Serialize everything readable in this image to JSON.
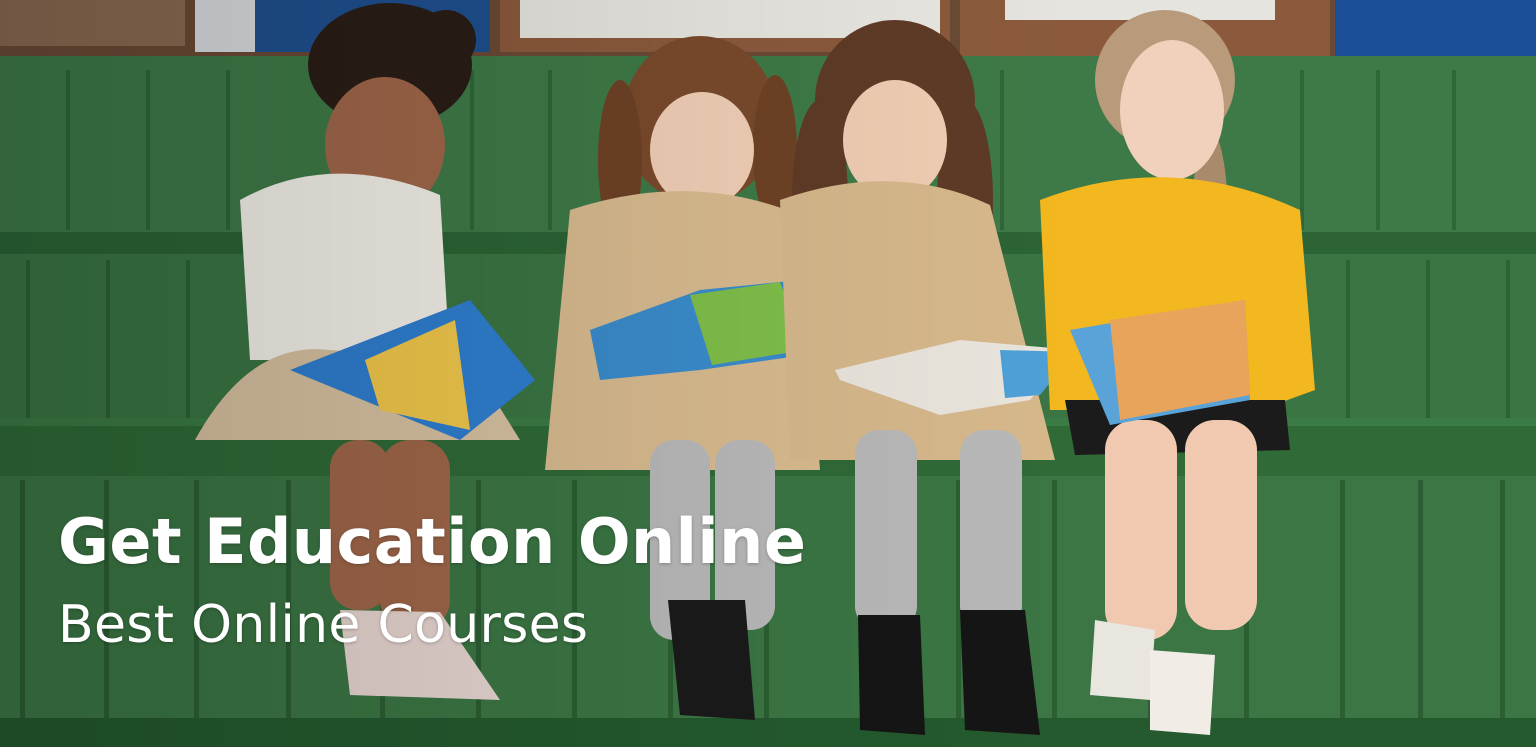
{
  "hero": {
    "title": "Get Education Online",
    "subtitle": "Best Online Courses",
    "image_subject": "four-girls-reading-books-on-green-bench",
    "colors": {
      "wall_green": "#3f7b48",
      "bench_green": "#2e6a37",
      "text": "#ffffff"
    }
  }
}
